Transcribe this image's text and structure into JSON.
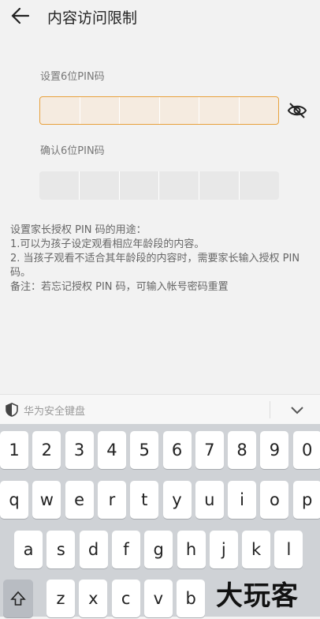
{
  "header": {
    "title": "内容访问限制"
  },
  "pin": {
    "set_label": "设置6位PIN码",
    "confirm_label": "确认6位PIN码"
  },
  "info": {
    "heading": "设置家长授权 PIN 码的用途：",
    "line1": "1.可以为孩子设定观看相应年龄段的内容。",
    "line2": "2. 当孩子观看不适合其年龄段的内容时，需要家长输入授权 PIN 码。",
    "note": "备注：若忘记授权 PIN 码，可输入帐号密码重置"
  },
  "keyboard": {
    "title": "华为安全键盘",
    "row_numbers": [
      "1",
      "2",
      "3",
      "4",
      "5",
      "6",
      "7",
      "8",
      "9",
      "0"
    ],
    "row_qwerty": [
      "q",
      "w",
      "e",
      "r",
      "t",
      "y",
      "u",
      "i",
      "o",
      "p"
    ],
    "row_asdf": [
      "a",
      "s",
      "d",
      "f",
      "g",
      "h",
      "j",
      "k",
      "l"
    ],
    "row_zxcv": [
      "z",
      "x",
      "c",
      "v",
      "b"
    ]
  },
  "watermark": "大玩客",
  "colors": {
    "accent": "#e8a13c",
    "pin_active_bg": "#f5ebe0",
    "keyboard_bg": "#cfd2d6"
  },
  "icons": [
    "back-arrow-icon",
    "eye-off-icon",
    "shield-icon",
    "chevron-down-icon",
    "shift-icon"
  ]
}
